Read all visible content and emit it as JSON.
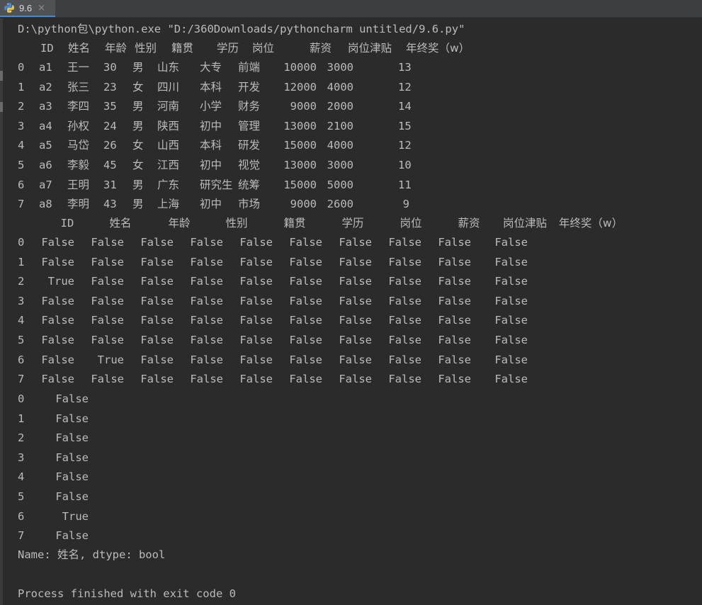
{
  "tab": {
    "title": "9.6",
    "icon": "python-icon",
    "close_glyph": "×"
  },
  "console": {
    "command": "D:\\python包\\python.exe \"D:/360Downloads/pythoncharm untitled/9.6.py\"",
    "df_header": [
      "ID",
      "姓名",
      "年龄",
      "性别",
      "籍贯",
      "学历",
      "岗位",
      "薪资",
      "岗位津贴",
      "年终奖（w）"
    ],
    "df_rows": [
      [
        "0",
        "a1",
        "王一",
        "30",
        "男",
        "山东",
        "大专",
        "前端",
        "10000",
        "3000",
        "13"
      ],
      [
        "1",
        "a2",
        "张三",
        "23",
        "女",
        "四川",
        "本科",
        "开发",
        "12000",
        "4000",
        "12"
      ],
      [
        "2",
        "a3",
        "李四",
        "35",
        "男",
        "河南",
        "小学",
        "财务",
        "9000",
        "2000",
        "14"
      ],
      [
        "3",
        "a4",
        "孙权",
        "24",
        "男",
        "陕西",
        "初中",
        "管理",
        "13000",
        "2100",
        "15"
      ],
      [
        "4",
        "a5",
        "马岱",
        "26",
        "女",
        "山西",
        "本科",
        "研发",
        "15000",
        "4000",
        "12"
      ],
      [
        "5",
        "a6",
        "李毅",
        "45",
        "女",
        "江西",
        "初中",
        "视觉",
        "13000",
        "3000",
        "10"
      ],
      [
        "6",
        "a7",
        "王明",
        "31",
        "男",
        "广东",
        "研究生",
        "统筹",
        "15000",
        "5000",
        "11"
      ],
      [
        "7",
        "a8",
        "李明",
        "43",
        "男",
        "上海",
        "初中",
        "市场",
        "9000",
        "2600",
        "9"
      ]
    ],
    "dup_header": [
      "ID",
      "姓名",
      "年龄",
      "性别",
      "籍贯",
      "学历",
      "岗位",
      "薪资",
      "岗位津贴",
      "年终奖（w）"
    ],
    "dup_rows": [
      [
        "0",
        "False",
        "False",
        "False",
        "False",
        "False",
        "False",
        "False",
        "False",
        "False",
        "False"
      ],
      [
        "1",
        "False",
        "False",
        "False",
        "False",
        "False",
        "False",
        "False",
        "False",
        "False",
        "False"
      ],
      [
        "2",
        "True",
        "False",
        "False",
        "False",
        "False",
        "False",
        "False",
        "False",
        "False",
        "False"
      ],
      [
        "3",
        "False",
        "False",
        "False",
        "False",
        "False",
        "False",
        "False",
        "False",
        "False",
        "False"
      ],
      [
        "4",
        "False",
        "False",
        "False",
        "False",
        "False",
        "False",
        "False",
        "False",
        "False",
        "False"
      ],
      [
        "5",
        "False",
        "False",
        "False",
        "False",
        "False",
        "False",
        "False",
        "False",
        "False",
        "False"
      ],
      [
        "6",
        "False",
        "True",
        "False",
        "False",
        "False",
        "False",
        "False",
        "False",
        "False",
        "False"
      ],
      [
        "7",
        "False",
        "False",
        "False",
        "False",
        "False",
        "False",
        "False",
        "False",
        "False",
        "False"
      ]
    ],
    "series_rows": [
      [
        "0",
        "False"
      ],
      [
        "1",
        "False"
      ],
      [
        "2",
        "False"
      ],
      [
        "3",
        "False"
      ],
      [
        "4",
        "False"
      ],
      [
        "5",
        "False"
      ],
      [
        "6",
        "True"
      ],
      [
        "7",
        "False"
      ]
    ],
    "series_footer": "Name: 姓名, dtype: bool",
    "exit_message": "Process finished with exit code 0"
  },
  "colors": {
    "background": "#2b2b2b",
    "text": "#bbbbbb",
    "tab_bar": "#3c3f41",
    "tab_active": "#4e5254",
    "tab_underline": "#4a88c7"
  }
}
